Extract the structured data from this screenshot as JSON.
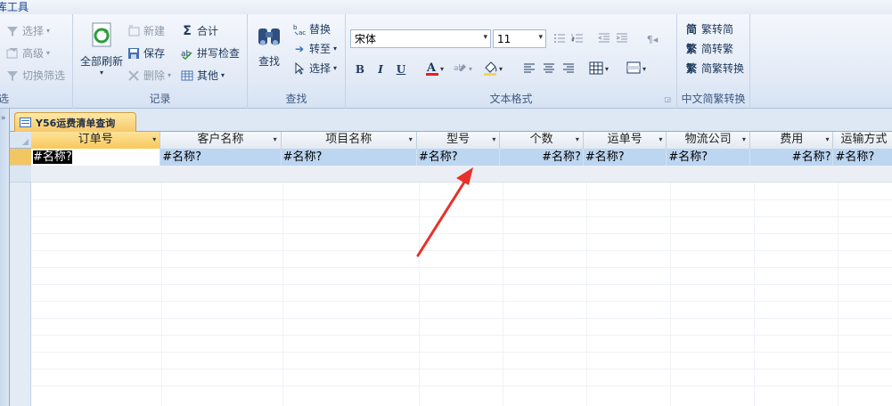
{
  "app": {
    "ribbon_tab_title": "库工具"
  },
  "ribbon": {
    "filter_group": {
      "label": "选",
      "items": [
        {
          "label": "选择",
          "icon": "filter-select-icon"
        },
        {
          "label": "高级",
          "icon": "filter-advanced-icon"
        },
        {
          "label": "切换筛选",
          "icon": "toggle-filter-icon"
        }
      ]
    },
    "records_group": {
      "label": "记录",
      "refresh_all": "全部刷新",
      "new": "新建",
      "save": "保存",
      "delete": "删除",
      "totals": "合计",
      "spelling": "拼写检查",
      "more": "其他"
    },
    "find_group": {
      "label": "查找",
      "find": "查找",
      "replace": "替换",
      "goto": "转至",
      "select": "选择"
    },
    "text_format_group": {
      "label": "文本格式",
      "font_name": "宋体",
      "font_size": "11",
      "bold": "B",
      "italic": "I",
      "underline": "U",
      "font_color": "#e02020",
      "highlight_color": "#f1d35b"
    },
    "chinese_convert_group": {
      "label": "中文简繁转换",
      "to_simplified": "繁转简",
      "to_traditional": "简转繁",
      "convert": "简繁转换"
    }
  },
  "document_tab": {
    "title": "Y56运费清单查询"
  },
  "datasheet": {
    "columns": [
      "订单号",
      "客户名称",
      "项目名称",
      "型号",
      "个数",
      "运单号",
      "物流公司",
      "费用",
      "运输方式"
    ],
    "row": [
      "#名称?",
      "#名称?",
      "#名称?",
      "#名称?",
      "#名称?",
      "#名称?",
      "#名称?",
      "#名称?",
      "#名称?"
    ]
  },
  "colors": {
    "accent_tab": "#f8c85a",
    "row_highlight": "#bcd5f1",
    "arrow": "#e8312a"
  }
}
